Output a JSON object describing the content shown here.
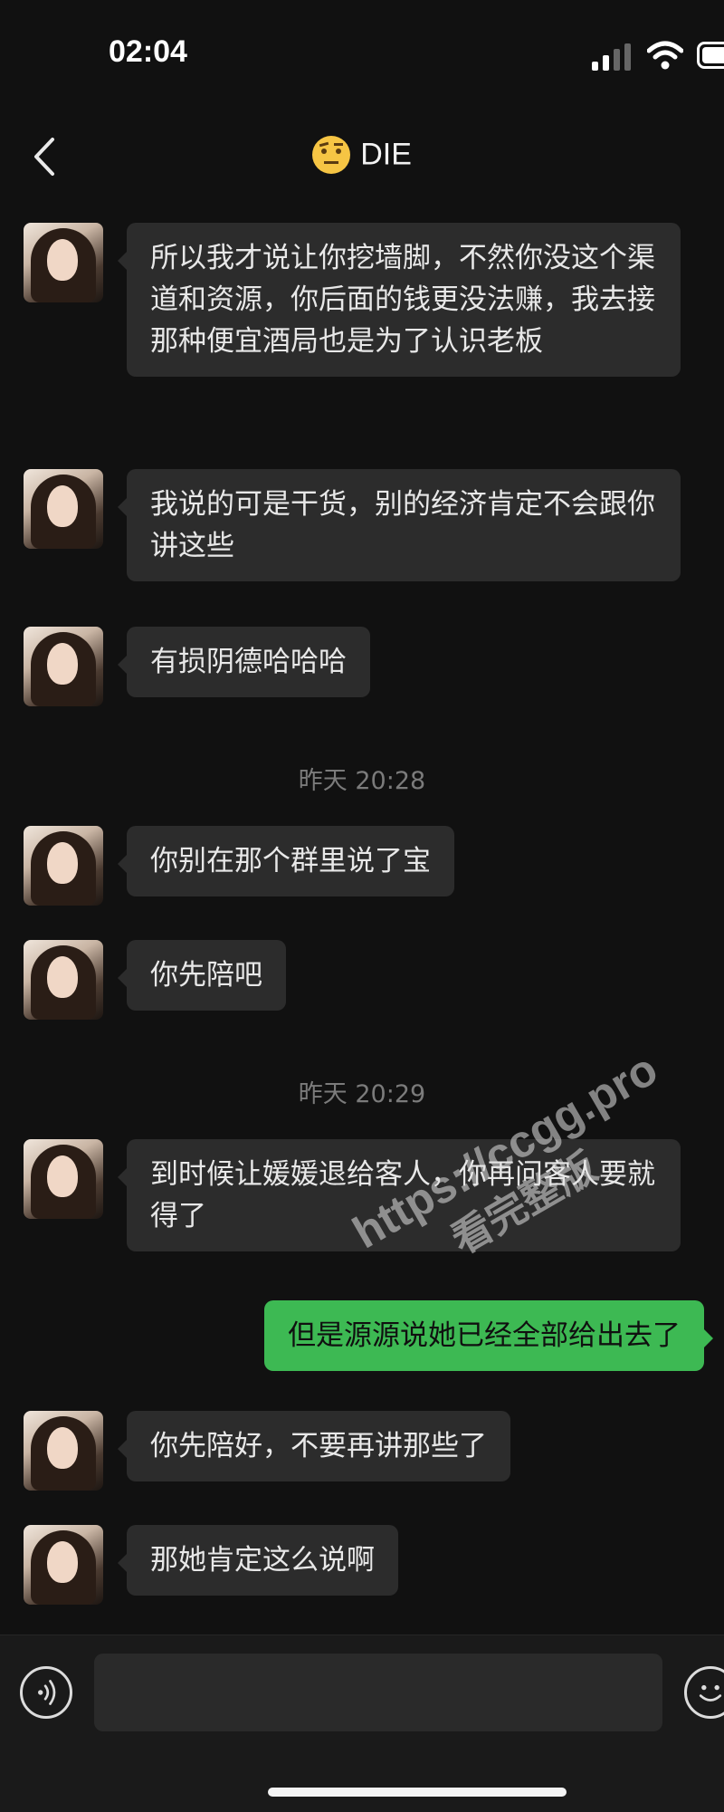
{
  "status": {
    "time": "02:04"
  },
  "header": {
    "title": "DIE",
    "title_emoji": "raised-eyebrow-face-icon"
  },
  "messages": [
    {
      "from": "them",
      "text": "所以我才说让你挖墙脚，不然你没这个渠道和资源，你后面的钱更没法赚，我去接那种便宜酒局也是为了认识老板"
    },
    {
      "from": "them",
      "text": "我说的可是干货，别的经济肯定不会跟你讲这些"
    },
    {
      "from": "them",
      "text": "有损阴德哈哈哈"
    },
    {
      "type": "timestamp",
      "text": "昨天 20:28"
    },
    {
      "from": "them",
      "text": "你别在那个群里说了宝"
    },
    {
      "from": "them",
      "text": "你先陪吧"
    },
    {
      "type": "timestamp",
      "text": "昨天 20:29"
    },
    {
      "from": "them",
      "text": "到时候让媛媛退给客人，你再问客人要就得了"
    },
    {
      "from": "me",
      "text": "但是源源说她已经全部给出去了"
    },
    {
      "from": "them",
      "text": "你先陪好，不要再讲那些了"
    },
    {
      "from": "them",
      "text": "那她肯定这么说啊"
    }
  ],
  "watermark": {
    "line1": "https://ccgg.pro",
    "line2": "看完整版"
  },
  "input": {
    "placeholder": ""
  },
  "colors": {
    "background": "#111111",
    "incoming_bubble": "#2c2c2c",
    "outgoing_bubble": "#3db953",
    "timestamp": "#7b7b7b"
  }
}
